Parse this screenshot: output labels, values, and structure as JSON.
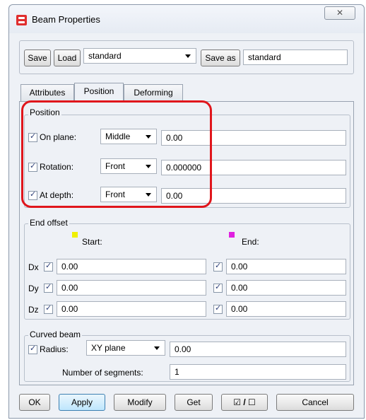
{
  "window": {
    "title": "Beam Properties",
    "close_glyph": "✕"
  },
  "toolbar": {
    "save_label": "Save",
    "load_label": "Load",
    "preset_value": "standard",
    "save_as_label": "Save as",
    "save_as_value": "standard"
  },
  "tabs": [
    {
      "label": "Attributes"
    },
    {
      "label": "Position"
    },
    {
      "label": "Deforming"
    }
  ],
  "active_tab": "Position",
  "position": {
    "title": "Position",
    "on_plane": {
      "label": "On plane:",
      "checked": true,
      "option": "Middle",
      "value": "0.00"
    },
    "rotation": {
      "label": "Rotation:",
      "checked": true,
      "option": "Front",
      "value": "0.000000"
    },
    "at_depth": {
      "label": "At depth:",
      "checked": true,
      "option": "Front",
      "value": "0.00"
    }
  },
  "end_offset": {
    "title": "End offset",
    "start_label": "Start:",
    "end_label": "End:",
    "start_color": "#f0f000",
    "end_color": "#e020e0",
    "rows": [
      {
        "axis": "Dx",
        "start": "0.00",
        "end": "0.00"
      },
      {
        "axis": "Dy",
        "start": "0.00",
        "end": "0.00"
      },
      {
        "axis": "Dz",
        "start": "0.00",
        "end": "0.00"
      }
    ]
  },
  "curved_beam": {
    "title": "Curved beam",
    "radius_label": "Radius:",
    "radius_checked": true,
    "plane_option": "XY plane",
    "radius_value": "0.00",
    "segments_label": "Number of segments:",
    "segments_value": "1"
  },
  "footer": {
    "ok_label": "OK",
    "apply_label": "Apply",
    "modify_label": "Modify",
    "get_label": "Get",
    "toggle_label": "☑ / ☐",
    "cancel_label": "Cancel"
  },
  "highlight_color": "#e0161c"
}
